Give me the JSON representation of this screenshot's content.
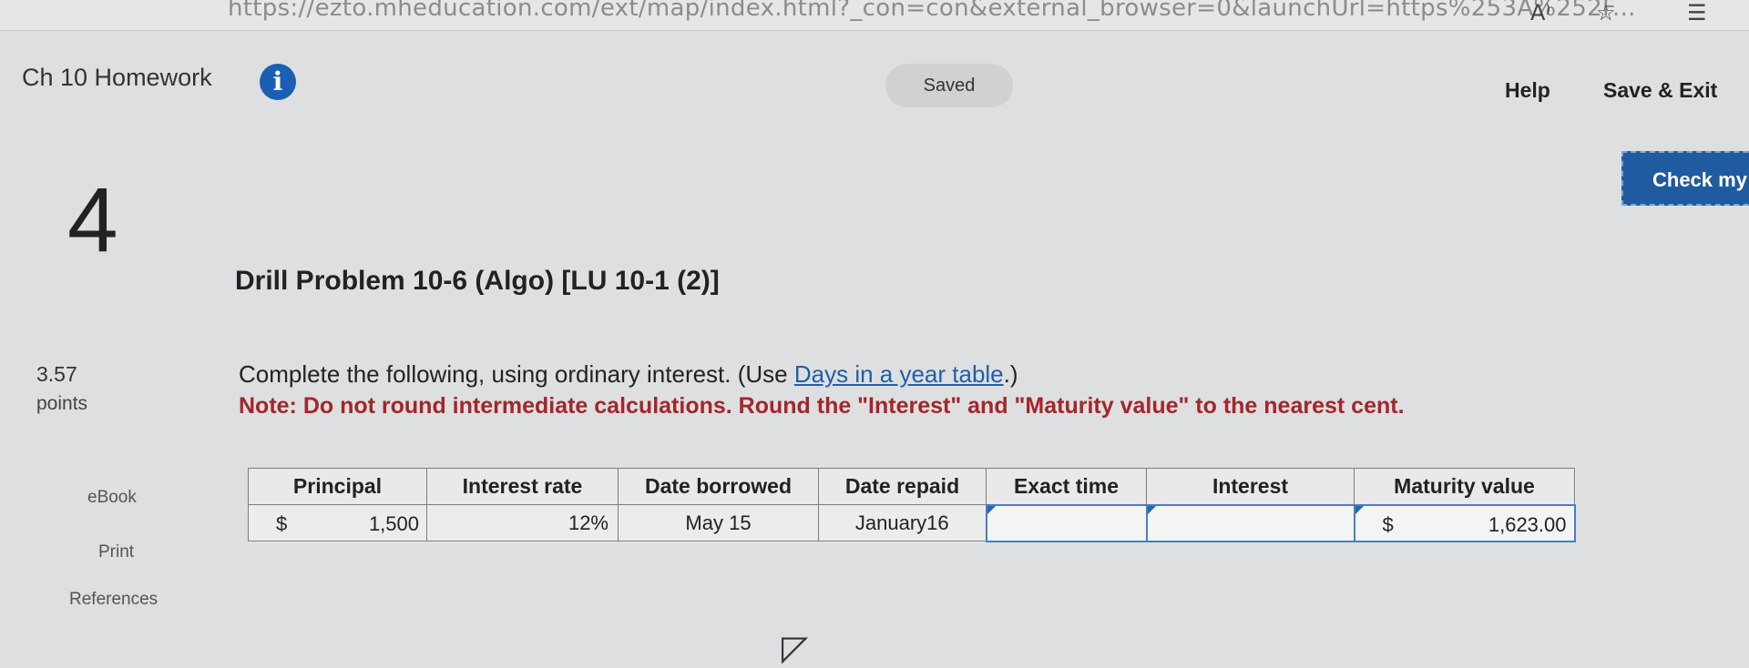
{
  "browser": {
    "url": "https://ezto.mheducation.com/ext/map/index.html?_con=con&external_browser=0&launchUrl=https%253A%252F...",
    "icons": [
      "read-aloud-icon",
      "add-favorite-icon",
      "favorites-icon"
    ]
  },
  "header": {
    "assignment_title": "Ch 10 Homework",
    "info_glyph": "i",
    "status": "Saved",
    "help_label": "Help",
    "save_exit_label": "Save & Exit",
    "check_label": "Check my work"
  },
  "question": {
    "number": "4",
    "title": "Drill Problem 10-6 (Algo) [LU 10-1 (2)]",
    "points_value": "3.57",
    "points_label": "points",
    "instruction_prefix": "Complete the following, using ordinary interest. (Use ",
    "instruction_link": "Days in a year table",
    "instruction_suffix": ".)",
    "note": "Note: Do not round intermediate calculations. Round the \"Interest\" and \"Maturity value\" to the nearest cent."
  },
  "sidebar": {
    "ebook": "eBook",
    "print": "Print",
    "references": "References"
  },
  "table": {
    "headers": [
      "Principal",
      "Interest rate",
      "Date borrowed",
      "Date repaid",
      "Exact time",
      "Interest",
      "Maturity value"
    ],
    "row": {
      "principal_symbol": "$",
      "principal": "1,500",
      "interest_rate": "12%",
      "date_borrowed": "May 15",
      "date_repaid": "January16",
      "exact_time": "",
      "interest": "",
      "maturity_symbol": "$",
      "maturity_value": "1,623.00"
    }
  },
  "colors": {
    "accent_blue": "#1f5b9e",
    "note_red": "#a3262b",
    "link_blue": "#1e5fa8"
  }
}
